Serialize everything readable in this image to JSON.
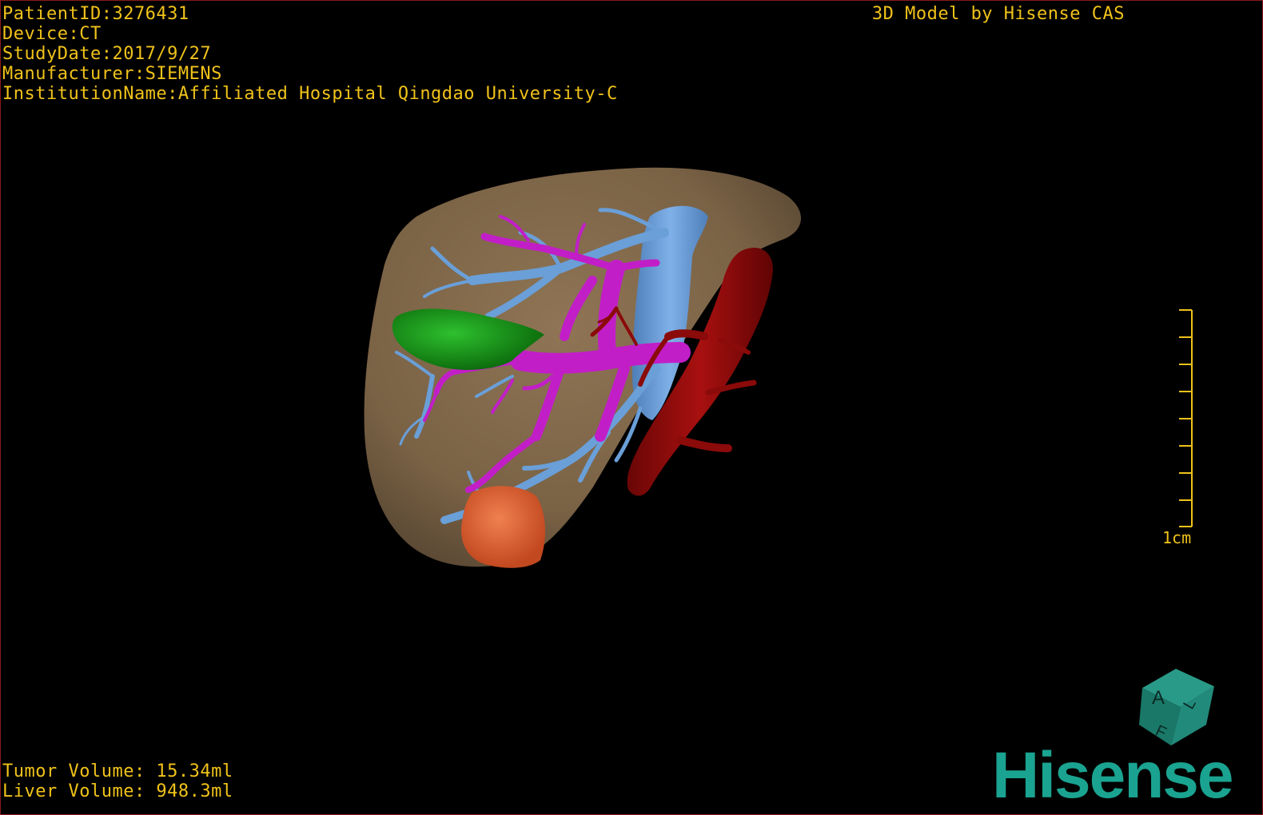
{
  "header": {
    "patient_id": "PatientID:3276431",
    "device": "Device:CT",
    "study_date": "StudyDate:2017/9/27",
    "manufacturer": "Manufacturer:SIEMENS",
    "institution": "InstitutionName:Affiliated Hospital Qingdao University-C",
    "brand_title": "3D Model by Hisense CAS"
  },
  "volumes": {
    "tumor": "Tumor Volume: 15.34ml",
    "liver": "Liver Volume: 948.3ml"
  },
  "scale_bar": {
    "label": "1cm"
  },
  "orientation_cube": {
    "face_letters": [
      "A",
      "F",
      "L"
    ]
  },
  "logo": {
    "text": "Hisense"
  },
  "colors": {
    "overlay_text": "#f0c21a",
    "liver": "#8b6f4e",
    "hepatic_vein": "#6a9fd8",
    "portal_vein": "#c21ec8",
    "artery": "#8b0a0a",
    "gallbladder": "#1a9a1a",
    "tumor": "#e8623a",
    "logo": "#1aa390"
  }
}
